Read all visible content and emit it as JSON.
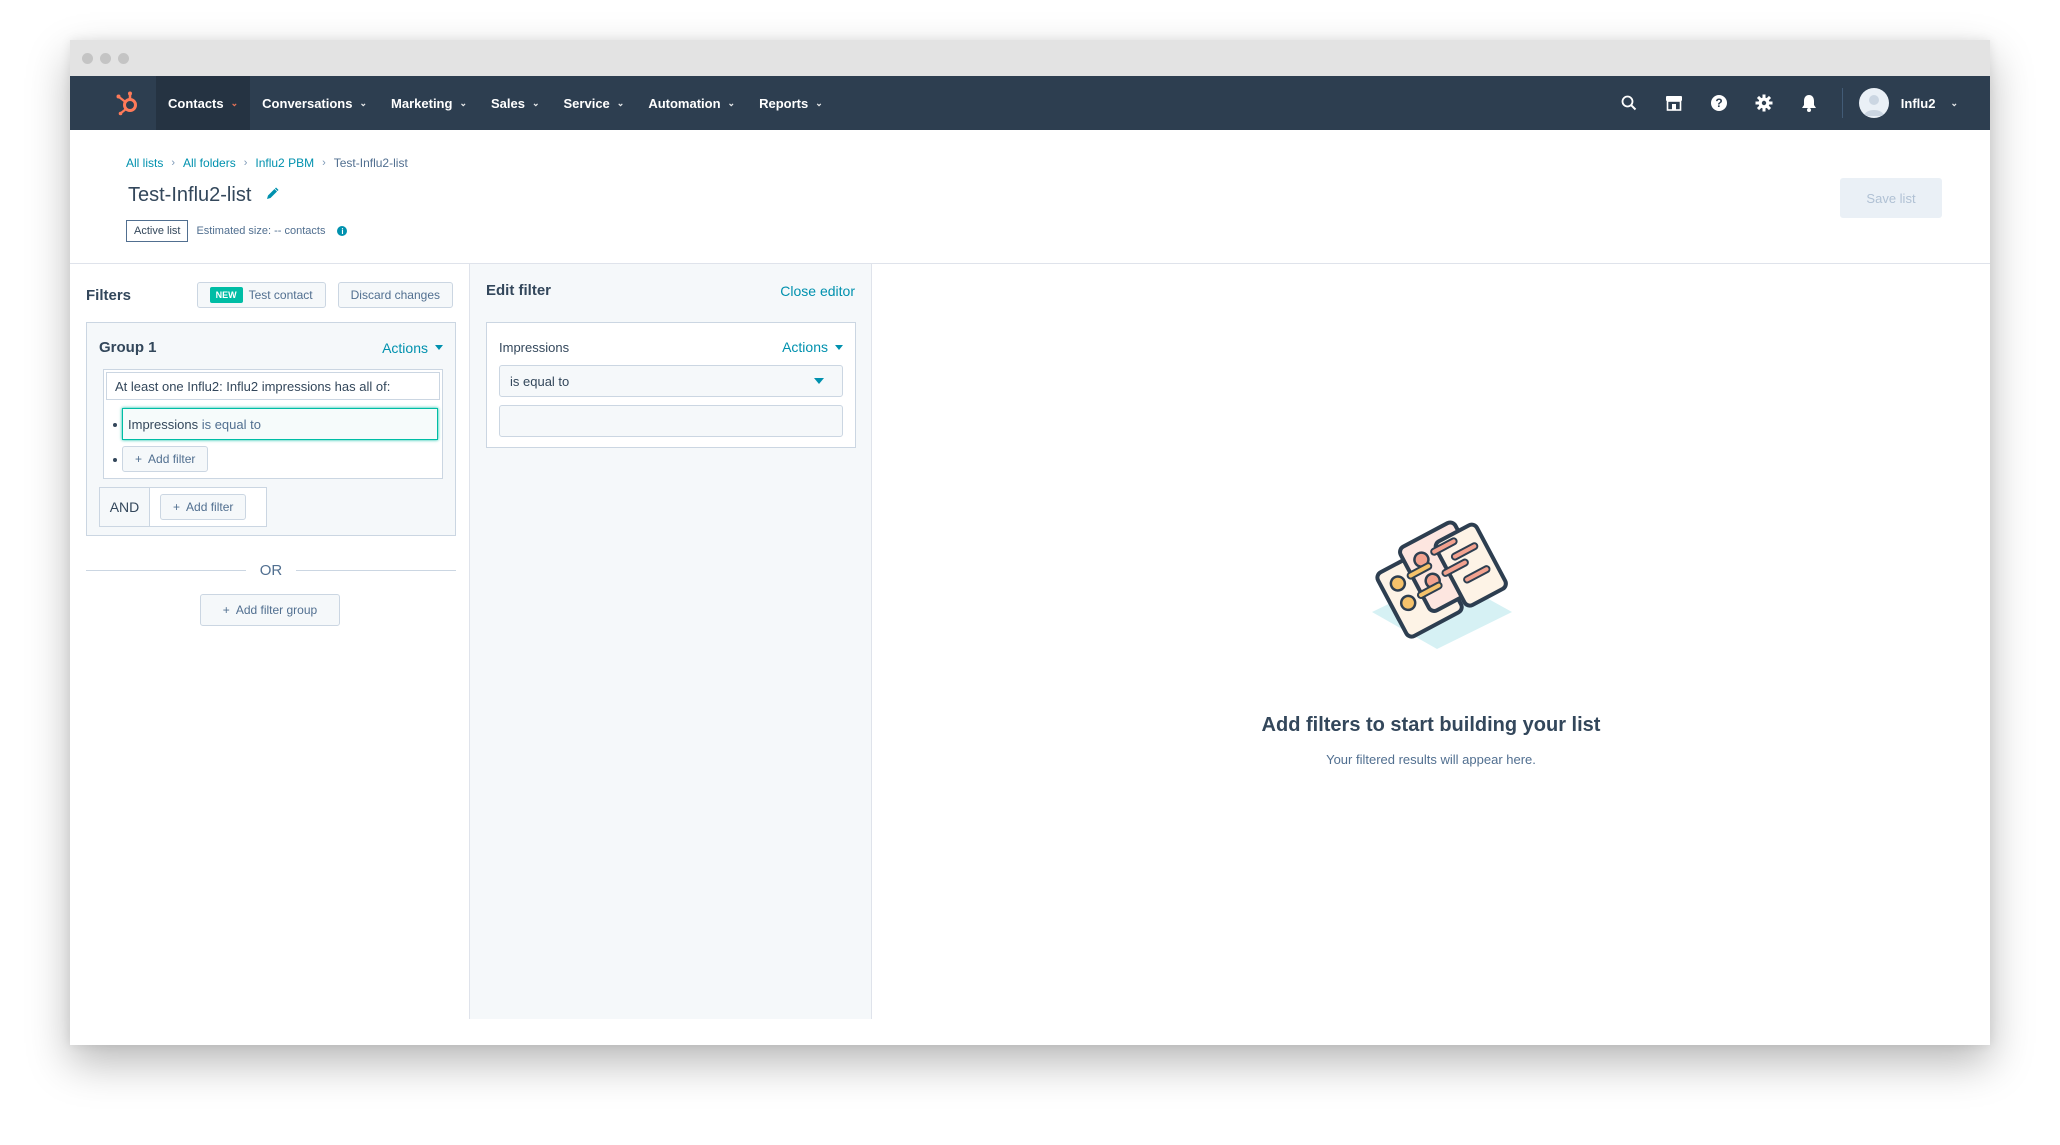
{
  "nav": {
    "items": [
      {
        "label": "Contacts",
        "active": true
      },
      {
        "label": "Conversations"
      },
      {
        "label": "Marketing"
      },
      {
        "label": "Sales"
      },
      {
        "label": "Service"
      },
      {
        "label": "Automation"
      },
      {
        "label": "Reports"
      }
    ],
    "account_name": "Influ2",
    "icons": [
      "search-icon",
      "marketplace-icon",
      "help-icon",
      "settings-icon",
      "notifications-icon"
    ]
  },
  "breadcrumb": [
    "All lists",
    "All folders",
    "Influ2 PBM",
    "Test-Influ2-list"
  ],
  "page": {
    "title": "Test-Influ2-list",
    "status_badge": "Active list",
    "estimated_size": "Estimated size: -- contacts",
    "save_label": "Save list"
  },
  "filters": {
    "title": "Filters",
    "new_badge": "NEW",
    "test_contact": "Test contact",
    "discard": "Discard changes",
    "group": {
      "title": "Group 1",
      "actions": "Actions",
      "rule_label": "At least one Influ2: Influ2 impressions has all of:",
      "condition_property": "Impressions",
      "condition_operator": "is equal to",
      "add_filter": "Add filter",
      "and_label": "AND",
      "and_add_filter": "Add filter"
    },
    "or_label": "OR",
    "add_group": "Add filter group"
  },
  "edit_filter": {
    "title": "Edit filter",
    "close": "Close editor",
    "property": "Impressions",
    "actions": "Actions",
    "operator": "is equal to",
    "value": ""
  },
  "empty_state": {
    "title": "Add filters to start building your list",
    "subtitle": "Your filtered results will appear here."
  },
  "colors": {
    "nav_bg": "#2d3e50",
    "accent": "#0091ae",
    "brand": "#ff7a59",
    "success": "#00bda5"
  }
}
